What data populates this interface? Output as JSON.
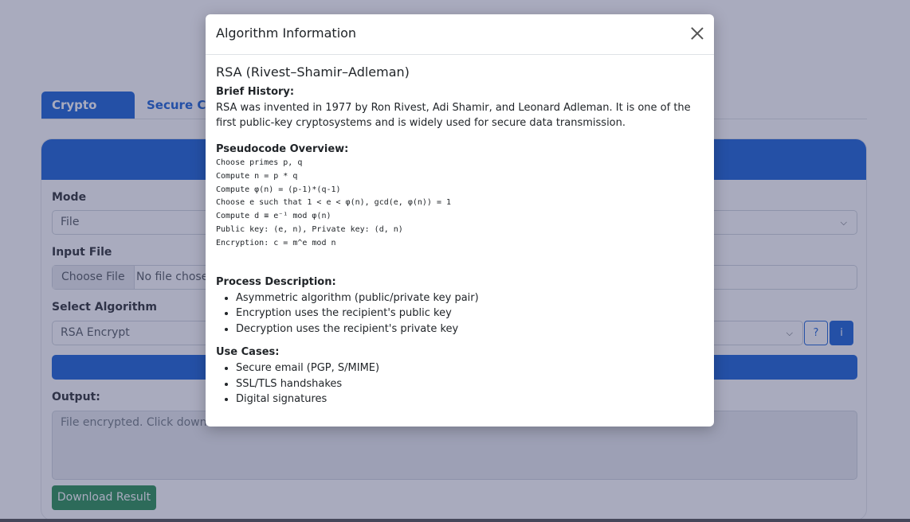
{
  "app": {
    "tabs": [
      "Crypto Tools",
      "Secure Ch"
    ],
    "mode_label": "Mode",
    "mode_value": "File",
    "input_file_label": "Input File",
    "choose_file_label": "Choose File",
    "no_file_label": "No file chosen",
    "select_algorithm_label": "Select Algorithm",
    "algorithm_value": "RSA Encrypt",
    "help_button_label": "?",
    "info_button_label": "i",
    "output_label": "Output:",
    "output_value": "File encrypted. Click downloa",
    "download_label": "Download Result"
  },
  "modal": {
    "title": "Algorithm Information",
    "algorithm_name": "RSA (Rivest–Shamir–Adleman)",
    "history_heading": "Brief History:",
    "history_text": "RSA was invented in 1977 by Ron Rivest, Adi Shamir, and Leonard Adleman. It is one of the first public-key cryptosystems and is widely used for secure data transmission.",
    "pseudocode_heading": "Pseudocode Overview:",
    "pseudocode": [
      "Choose primes p, q",
      "Compute n = p * q",
      "Compute φ(n) = (p-1)*(q-1)",
      "Choose e such that 1 < e < φ(n), gcd(e, φ(n)) = 1",
      "Compute d ≡ e⁻¹ mod φ(n)",
      "Public key: (e, n), Private key: (d, n)",
      "Encryption: c = m^e mod n"
    ],
    "process_heading": "Process Description:",
    "process_items": [
      "Asymmetric algorithm (public/private key pair)",
      "Encryption uses the recipient's public key",
      "Decryption uses the recipient's private key"
    ],
    "use_cases_heading": "Use Cases:",
    "use_cases": [
      "Secure email (PGP, S/MIME)",
      "SSL/TLS handshakes",
      "Digital signatures"
    ]
  },
  "colors": {
    "primary": "#0d5ad4",
    "success": "#1e8a4a",
    "backdrop": "rgba(64, 68, 110, 0.45)"
  }
}
